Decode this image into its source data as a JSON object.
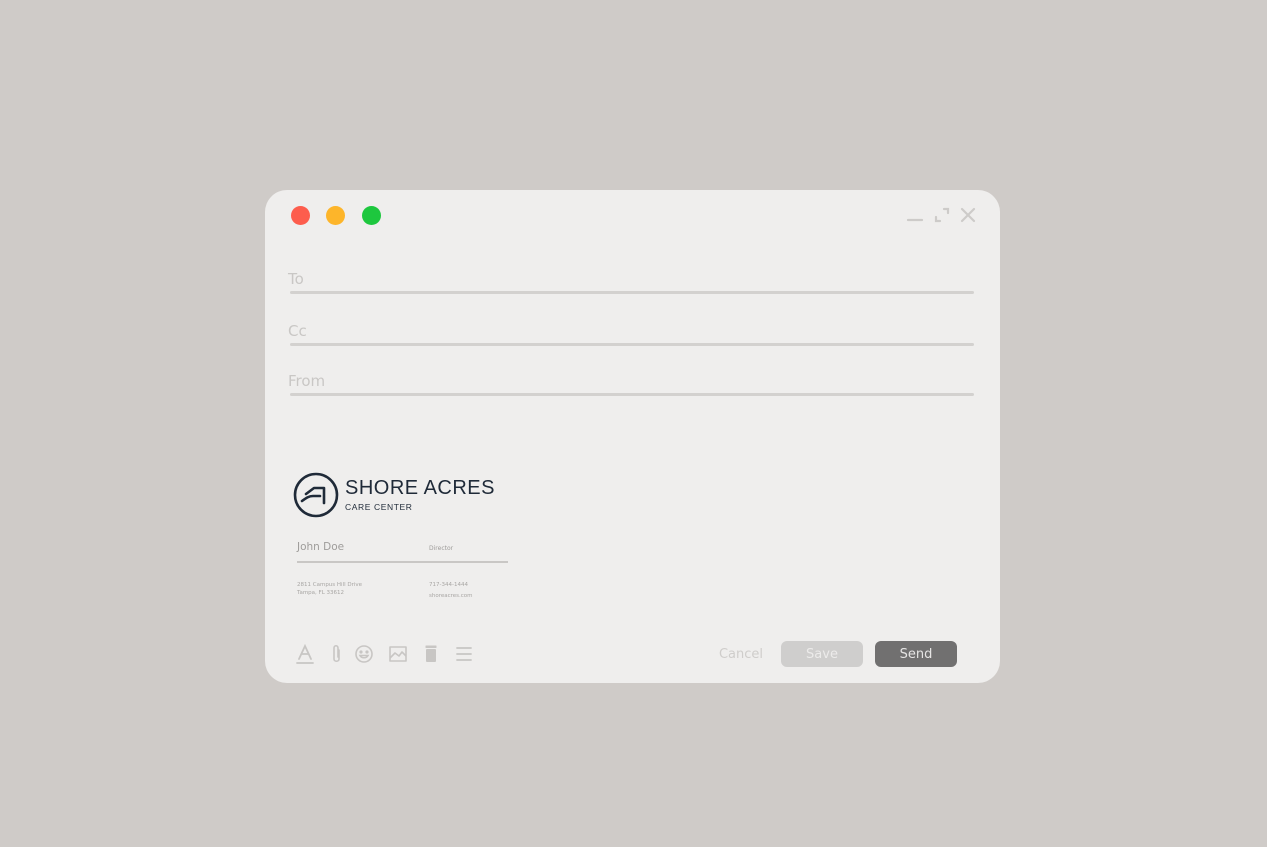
{
  "compose": {
    "fields": {
      "to": {
        "label": "To",
        "value": ""
      },
      "cc": {
        "label": "Cc",
        "value": ""
      },
      "from": {
        "label": "From",
        "value": ""
      }
    },
    "signature": {
      "brand": "SHORE ACRES",
      "brand_sub": "CARE CENTER",
      "name": "John Doe",
      "title": "Director",
      "address_line1": "2811 Campus Hill Drive",
      "address_line2": "Tampa, FL 33612",
      "phone": "717-344-1444",
      "website": "shoreacres.com"
    },
    "buttons": {
      "cancel": "Cancel",
      "save": "Save",
      "send": "Send"
    },
    "toolbar_icons": [
      "text-format-icon",
      "paperclip-icon",
      "emoji-icon",
      "image-icon",
      "trash-icon",
      "menu-icon"
    ]
  },
  "colors": {
    "background": "#cfcbc8",
    "window": "#efeeed",
    "traffic_close": "#fd5d4d",
    "traffic_minimize": "#fdb52a",
    "traffic_maximize": "#1dc73e",
    "brand": "#1f2a38",
    "send_button": "#717070",
    "save_button": "#cfcecd"
  }
}
